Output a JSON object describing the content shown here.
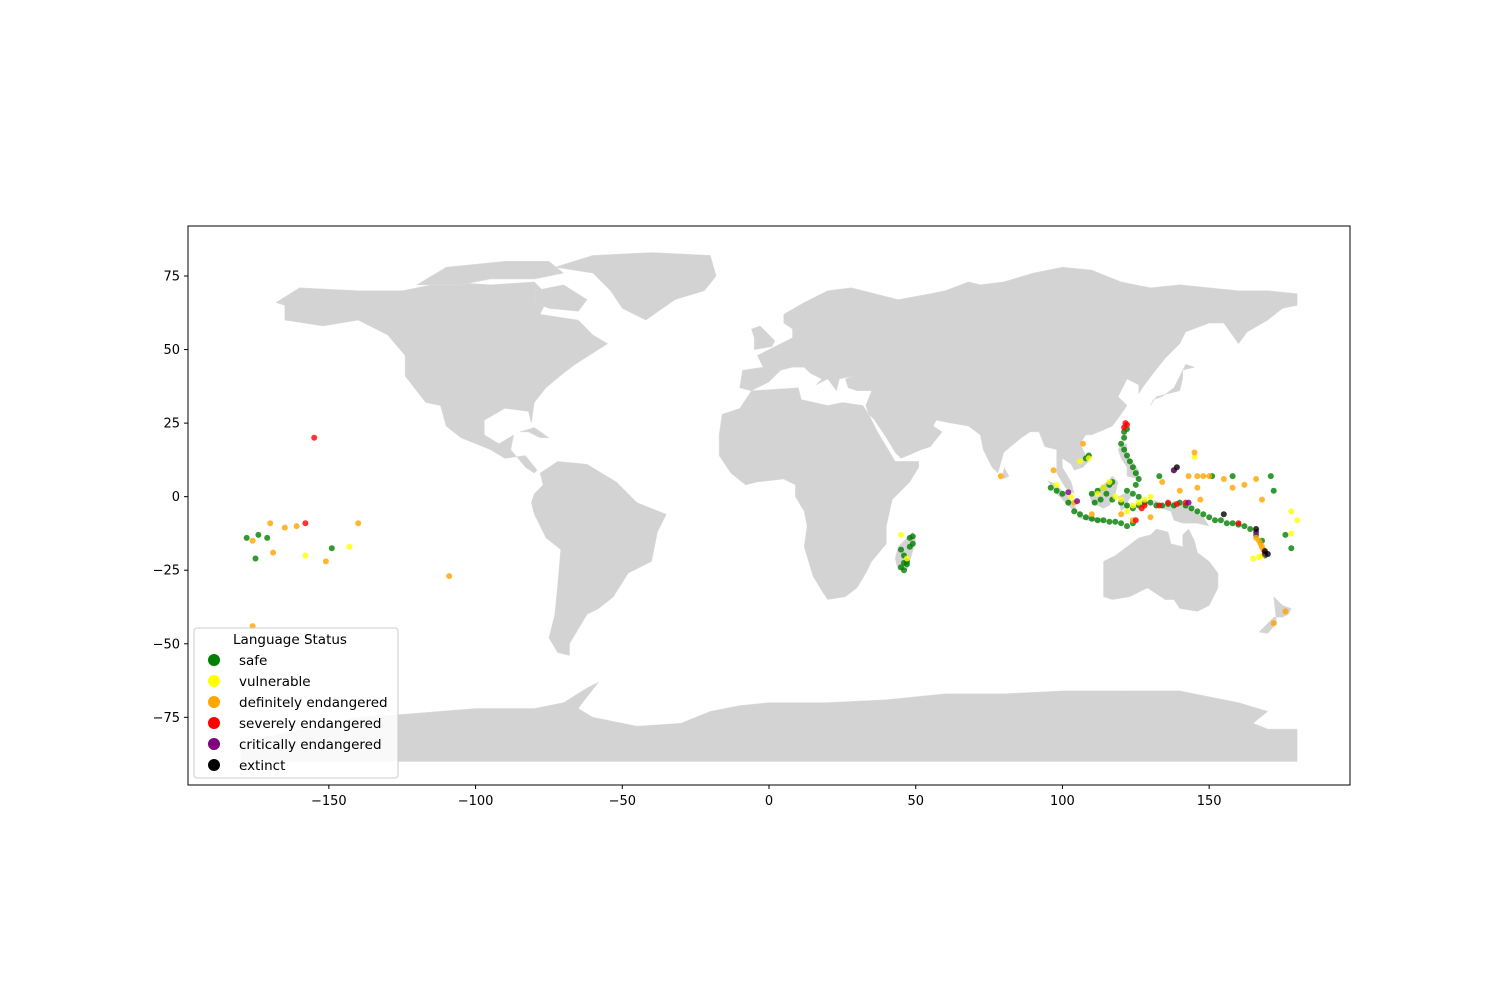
{
  "chart_data": {
    "type": "scatter",
    "subtype": "geographic map",
    "title": "",
    "xlabel": "",
    "ylabel": "",
    "xlim": [
      -198,
      198
    ],
    "ylim": [
      -98,
      92
    ],
    "xticks": [
      -150,
      -100,
      -50,
      0,
      50,
      100,
      150
    ],
    "yticks": [
      -75,
      -50,
      -25,
      0,
      25,
      50,
      75
    ],
    "grid": false,
    "land_color": "#d3d3d3",
    "legend": {
      "title": "Language Status",
      "placement": "lower-left",
      "entries": [
        {
          "label": "safe",
          "color": "#008000"
        },
        {
          "label": "vulnerable",
          "color": "#ffff00"
        },
        {
          "label": "definitely endangered",
          "color": "#ffa500"
        },
        {
          "label": "severely endangered",
          "color": "#ff0000"
        },
        {
          "label": "critically endangered",
          "color": "#800080"
        },
        {
          "label": "extinct",
          "color": "#000000"
        }
      ]
    },
    "series": [
      {
        "name": "safe",
        "color": "#008000",
        "points": [
          [
            -178,
            -14
          ],
          [
            -174,
            -13
          ],
          [
            -171,
            -14
          ],
          [
            -175,
            -21
          ],
          [
            -149,
            -17.5
          ],
          [
            45,
            -18
          ],
          [
            46,
            -20
          ],
          [
            47,
            -22
          ],
          [
            48,
            -14
          ],
          [
            49,
            -13.5
          ],
          [
            45,
            -24
          ],
          [
            46,
            -25
          ],
          [
            47,
            -23
          ],
          [
            48,
            -17
          ],
          [
            49,
            -16
          ],
          [
            46,
            -22.5
          ],
          [
            96,
            3
          ],
          [
            98,
            2
          ],
          [
            100,
            1
          ],
          [
            102,
            -2
          ],
          [
            104,
            -5
          ],
          [
            106,
            -6
          ],
          [
            108,
            -7
          ],
          [
            110,
            -7.5
          ],
          [
            112,
            -8
          ],
          [
            114,
            -8
          ],
          [
            116,
            -8.5
          ],
          [
            118,
            -8.5
          ],
          [
            120,
            -9
          ],
          [
            122,
            -10
          ],
          [
            124,
            -9
          ],
          [
            108,
            13
          ],
          [
            109,
            14
          ],
          [
            120,
            18
          ],
          [
            121,
            16
          ],
          [
            122,
            14
          ],
          [
            123,
            12
          ],
          [
            124,
            10
          ],
          [
            125,
            8
          ],
          [
            126,
            6
          ],
          [
            125,
            4
          ],
          [
            122,
            2
          ],
          [
            124,
            1
          ],
          [
            126,
            0
          ],
          [
            121,
            20
          ],
          [
            121,
            22
          ],
          [
            122,
            23
          ],
          [
            110,
            1
          ],
          [
            112,
            2
          ],
          [
            114,
            3
          ],
          [
            116,
            4
          ],
          [
            117,
            5
          ],
          [
            115,
            1
          ],
          [
            113,
            -1
          ],
          [
            111,
            -2
          ],
          [
            117,
            -1
          ],
          [
            120,
            -2
          ],
          [
            122,
            -3
          ],
          [
            124,
            -4
          ],
          [
            126,
            -3
          ],
          [
            128,
            -2
          ],
          [
            130,
            -2
          ],
          [
            132,
            -3
          ],
          [
            134,
            -3
          ],
          [
            136,
            -2.5
          ],
          [
            138,
            -3
          ],
          [
            140,
            -2
          ],
          [
            142,
            -3
          ],
          [
            144,
            -4
          ],
          [
            146,
            -5
          ],
          [
            148,
            -6
          ],
          [
            150,
            -7
          ],
          [
            152,
            -8
          ],
          [
            154,
            -8
          ],
          [
            156,
            -9
          ],
          [
            158,
            -9
          ],
          [
            160,
            -9.5
          ],
          [
            162,
            -10
          ],
          [
            164,
            -11
          ],
          [
            166,
            -13
          ],
          [
            168,
            -15
          ],
          [
            133,
            7
          ],
          [
            138,
            9
          ],
          [
            151,
            7
          ],
          [
            158,
            7
          ],
          [
            171,
            7
          ],
          [
            172,
            2
          ],
          [
            178,
            -17.5
          ],
          [
            176,
            -13
          ],
          [
            169,
            -20
          ]
        ]
      },
      {
        "name": "vulnerable",
        "color": "#ffff00",
        "points": [
          [
            -158,
            -20
          ],
          [
            -143,
            -17
          ],
          [
            45,
            -13
          ],
          [
            47,
            -21
          ],
          [
            98,
            4
          ],
          [
            103,
            0
          ],
          [
            106,
            12
          ],
          [
            109,
            13
          ],
          [
            112,
            1
          ],
          [
            114,
            3
          ],
          [
            116,
            5
          ],
          [
            118,
            0
          ],
          [
            120,
            -1
          ],
          [
            122,
            -5
          ],
          [
            124,
            -3
          ],
          [
            126,
            -2
          ],
          [
            128,
            -1
          ],
          [
            145,
            13.5
          ],
          [
            130,
            0
          ],
          [
            165,
            -21
          ],
          [
            167,
            -20.5
          ],
          [
            168,
            -20
          ],
          [
            178,
            -5
          ],
          [
            180,
            -8
          ],
          [
            178,
            -12.5
          ]
        ]
      },
      {
        "name": "definitely endangered",
        "color": "#ffa500",
        "points": [
          [
            -170,
            -9
          ],
          [
            -165,
            -10.5
          ],
          [
            -161,
            -10
          ],
          [
            -176,
            -15
          ],
          [
            -169,
            -19
          ],
          [
            -151,
            -22
          ],
          [
            -140,
            -9
          ],
          [
            -109,
            -27
          ],
          [
            -176,
            -44
          ],
          [
            79,
            7
          ],
          [
            97,
            9
          ],
          [
            104,
            -2
          ],
          [
            107,
            18
          ],
          [
            110,
            -6
          ],
          [
            120,
            -6
          ],
          [
            124,
            -8
          ],
          [
            130,
            -7
          ],
          [
            134,
            5
          ],
          [
            140,
            2
          ],
          [
            143,
            7
          ],
          [
            146,
            7
          ],
          [
            148,
            7
          ],
          [
            150,
            7
          ],
          [
            155,
            6
          ],
          [
            158,
            3
          ],
          [
            162,
            4
          ],
          [
            166,
            6
          ],
          [
            168,
            -1
          ],
          [
            145,
            15
          ],
          [
            146,
            3
          ],
          [
            147,
            -1
          ],
          [
            166,
            -14
          ],
          [
            167,
            -15
          ],
          [
            167.5,
            -16
          ],
          [
            168,
            -17
          ],
          [
            168.5,
            -18
          ],
          [
            172,
            -43
          ],
          [
            176,
            -39
          ]
        ]
      },
      {
        "name": "severely endangered",
        "color": "#ff0000",
        "points": [
          [
            -158,
            -9
          ],
          [
            -155,
            20
          ],
          [
            121,
            23.5
          ],
          [
            122,
            24.5
          ],
          [
            121.5,
            25
          ],
          [
            127,
            -4
          ],
          [
            128,
            -3
          ],
          [
            133,
            -3
          ],
          [
            136,
            -2
          ],
          [
            139,
            -2.5
          ],
          [
            142,
            -2
          ],
          [
            125,
            -8
          ],
          [
            160,
            -9
          ]
        ]
      },
      {
        "name": "critically endangered",
        "color": "#800080",
        "points": [
          [
            102,
            1.5
          ],
          [
            105,
            -1.5
          ],
          [
            138,
            9
          ],
          [
            143,
            -2
          ],
          [
            166,
            -12
          ],
          [
            169,
            -19.5
          ]
        ]
      },
      {
        "name": "extinct",
        "color": "#000000",
        "points": [
          [
            139,
            10
          ],
          [
            166,
            -11
          ],
          [
            169,
            -18.5
          ],
          [
            170,
            -19.5
          ],
          [
            155,
            -6
          ]
        ]
      }
    ]
  }
}
